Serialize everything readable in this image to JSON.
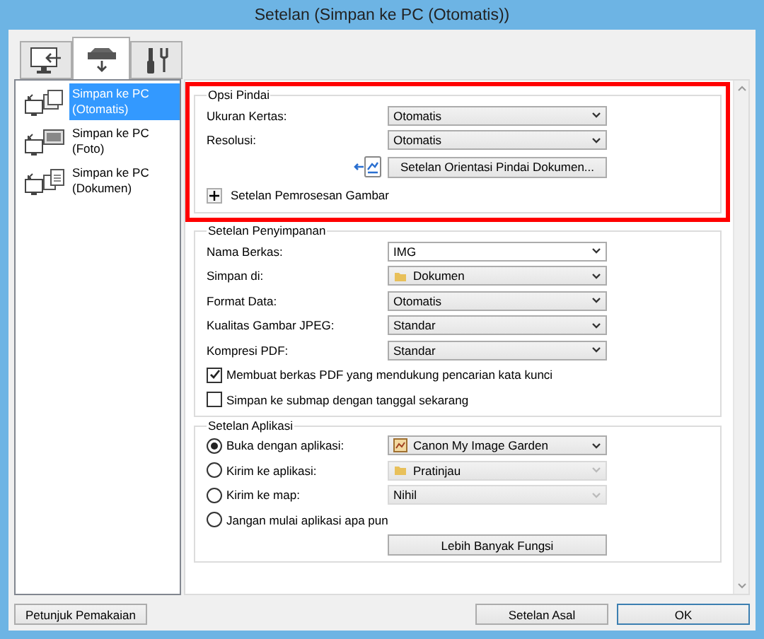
{
  "window": {
    "title": "Setelan (Simpan ke PC (Otomatis))"
  },
  "tabs": [
    {
      "kind": "computer",
      "selected": false
    },
    {
      "kind": "scanner",
      "selected": true
    },
    {
      "kind": "tools",
      "selected": false
    }
  ],
  "sidebar": {
    "items": [
      {
        "kind": "auto",
        "lines": [
          "Simpan ke PC",
          "(Otomatis)"
        ],
        "selected": true
      },
      {
        "kind": "photo",
        "lines": [
          "Simpan ke PC",
          "(Foto)"
        ],
        "selected": false
      },
      {
        "kind": "document",
        "lines": [
          "Simpan ke PC",
          "(Dokumen)"
        ],
        "selected": false
      }
    ]
  },
  "sections": [
    {
      "title": "Opsi Pindai",
      "highlighted": true,
      "rows": [
        {
          "kind": "dropdown",
          "label": "Ukuran Kertas:",
          "value": "Otomatis",
          "disabled": false
        },
        {
          "kind": "dropdown",
          "label": "Resolusi:",
          "value": "Otomatis",
          "disabled": false
        },
        {
          "kind": "button",
          "label": "Setelan Orientasi Pindai Dokumen..."
        },
        {
          "kind": "expander",
          "label": "Setelan Pemrosesan Gambar",
          "expanded": false
        }
      ]
    },
    {
      "title": "Setelan Penyimpanan",
      "highlighted": false,
      "rows": [
        {
          "kind": "dropdown",
          "label": "Nama Berkas:",
          "value": "IMG",
          "disabled": false
        },
        {
          "kind": "dropdown",
          "label": "Simpan di:",
          "value": "Dokumen",
          "disabled": false
        },
        {
          "kind": "dropdown",
          "label": "Format Data:",
          "value": "Otomatis",
          "disabled": false
        },
        {
          "kind": "dropdown",
          "label": "Kualitas Gambar JPEG:",
          "value": "Standar",
          "disabled": false
        },
        {
          "kind": "dropdown",
          "label": "Kompresi PDF:",
          "value": "Standar",
          "disabled": false
        },
        {
          "kind": "checkbox",
          "label": "Membuat berkas PDF yang mendukung pencarian kata kunci",
          "checked": true
        },
        {
          "kind": "checkbox",
          "label": "Simpan ke submap dengan tanggal sekarang",
          "checked": false
        }
      ]
    },
    {
      "title": "Setelan Aplikasi",
      "highlighted": false,
      "rows": [
        {
          "kind": "radio_dropdown",
          "label": "Buka dengan aplikasi:",
          "selected": true,
          "value": "Canon My Image Garden",
          "disabled": false
        },
        {
          "kind": "radio_dropdown",
          "label": "Kirim ke aplikasi:",
          "selected": false,
          "value": "Pratinjau",
          "disabled": true
        },
        {
          "kind": "radio_dropdown",
          "label": "Kirim ke map:",
          "selected": false,
          "value": "Nihil",
          "disabled": true
        },
        {
          "kind": "radio",
          "label": "Jangan mulai aplikasi apa pun",
          "selected": false
        },
        {
          "kind": "wide_button",
          "label": "Lebih Banyak Fungsi"
        }
      ]
    }
  ],
  "footer": {
    "buttons": [
      {
        "label": "Petunjuk Pemakaian",
        "default": false
      },
      {
        "label": "Setelan Asal",
        "default": false
      },
      {
        "label": "OK",
        "default": true
      }
    ]
  }
}
